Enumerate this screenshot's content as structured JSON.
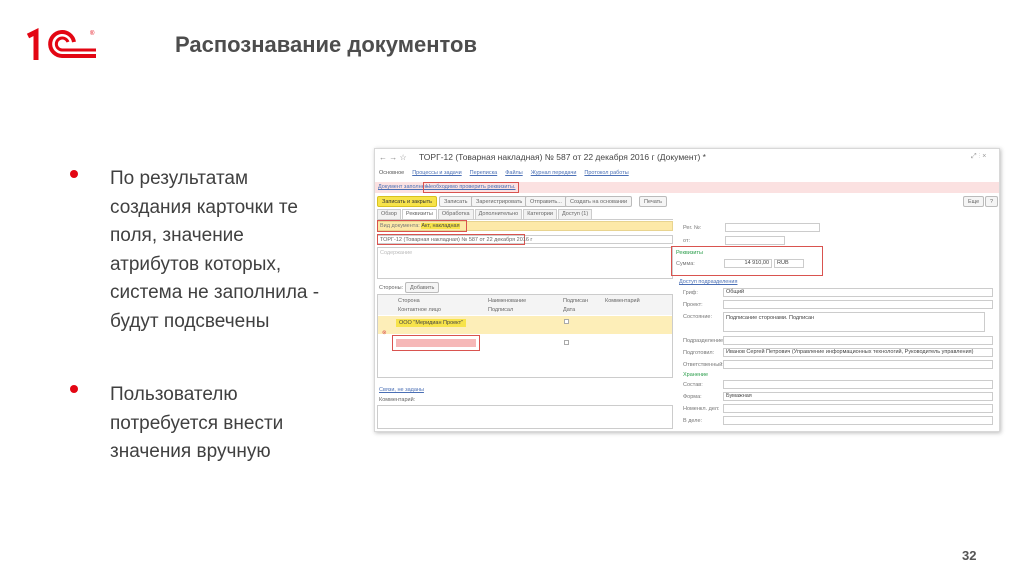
{
  "logo": {
    "text": "1С",
    "mark": "®"
  },
  "slide": {
    "title": "Распознавание документов",
    "bullets": [
      "По результатам создания карточки те поля, значение атрибутов которых, система не заполнила - будут подсвечены",
      "Пользователю потребуется внести значения вручную"
    ],
    "page_number": "32"
  },
  "screenshot": {
    "window_title": "ТОРГ-12 (Товарная накладная) № 587 от 22 декабря 2016 г (Документ) *",
    "nav": [
      "Основное",
      "Процессы и задачи",
      "Переписка",
      "Файлы",
      "Журнал передачи",
      "Протокол работы"
    ],
    "warning": {
      "prefix": "Документ заполнен.",
      "message": "Необходимо проверить реквизиты."
    },
    "toolbar": {
      "save_close": "Записать и закрыть",
      "save": "Записать",
      "register": "Зарегистрировать",
      "send": "Отправить...",
      "create_based": "Создать на основании",
      "print": "Печать",
      "more": "Еще",
      "help": "?"
    },
    "tabs": [
      "Обзор",
      "Реквизиты",
      "Обработка",
      "Дополнительно",
      "Категории",
      "Доступ (1)"
    ],
    "doc_kind_label": "Вид документа:",
    "doc_kind_value": "Акт, накладная",
    "doc_title_value": "ТОРГ-12 (Товарная накладная) № 587 от 22 декабря 2016 г",
    "summary_placeholder": "Содержание",
    "parties": {
      "label": "Стороны:",
      "add": "Добавить",
      "headers": [
        "Сторона",
        "Наименование",
        "Подписан",
        "Комментарий"
      ],
      "subheaders": [
        "Контактное лицо",
        "Подписал",
        "Дата"
      ],
      "rows": [
        {
          "party": "ООО \"Меридиан Проект\""
        },
        {
          "party": ""
        }
      ]
    },
    "links_label": "Связи, не заданы",
    "comment_label": "Комментарий:",
    "right": {
      "reg_no_label": "Рег. №:",
      "date_label": "от:",
      "details_label": "Реквизиты",
      "sum_label": "Сумма:",
      "sum_value": "14 910,00",
      "currency": "RUB",
      "delivery_link": "Доступ подразделения",
      "fields": [
        {
          "label": "Гриф:",
          "value": "Общий"
        },
        {
          "label": "Проект:",
          "value": ""
        },
        {
          "label": "Состояние:",
          "value": "Подписание сторонами. Подписан"
        },
        {
          "label": "Подразделение:",
          "value": ""
        },
        {
          "label": "Подготовил:",
          "value": "Иванов Сергей Петрович (Управление информационных технологий, Руководитель управления)"
        },
        {
          "label": "Ответственный:",
          "value": ""
        }
      ],
      "storage_label": "Хранение",
      "storage_fields": [
        {
          "label": "Состав:",
          "value": ""
        },
        {
          "label": "Форма:",
          "value": "Бумажная"
        },
        {
          "label": "Номенкл. дел:",
          "value": ""
        },
        {
          "label": "В деле:",
          "value": ""
        }
      ]
    }
  },
  "colors": {
    "brand": "#e30613",
    "highlight_red": "#d9534f",
    "warning_bg": "#fbe1e1",
    "yellow": "#fde9a8",
    "button_yellow": "#f7e34a"
  }
}
